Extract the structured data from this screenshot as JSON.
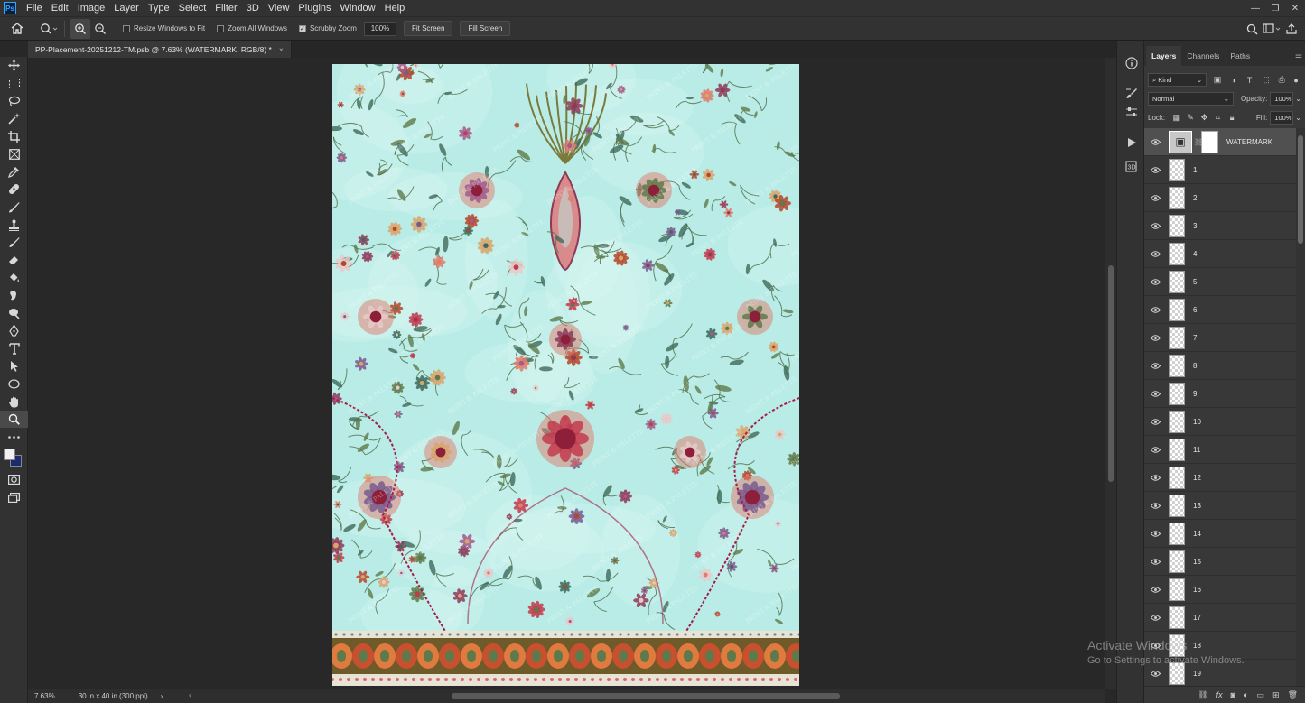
{
  "app": {
    "menu": [
      "File",
      "Edit",
      "Image",
      "Layer",
      "Type",
      "Select",
      "Filter",
      "3D",
      "View",
      "Plugins",
      "Window",
      "Help"
    ],
    "logo": "Ps"
  },
  "options": {
    "resize_windows": "Resize Windows to Fit",
    "zoom_all_windows": "Zoom All Windows",
    "scrubby_zoom": "Scrubby Zoom",
    "zoom_value": "100%",
    "fit_screen": "Fit Screen",
    "fill_screen": "Fill Screen"
  },
  "document": {
    "tab_title": "PP-Placement-20251212-TM.psb @ 7.63% (WATERMARK, RGB/8) *",
    "close": "×"
  },
  "status": {
    "zoom": "7.63%",
    "doc_info": "30 in x 40 in (300 ppi)",
    "arrow": "›"
  },
  "panel": {
    "tabs": [
      "Layers",
      "Channels",
      "Paths"
    ],
    "kind": "Kind",
    "blend_mode": "Normal",
    "opacity_label": "Opacity:",
    "opacity_value": "100%",
    "lock_label": "Lock:",
    "fill_label": "Fill:",
    "fill_value": "100%"
  },
  "layers": [
    {
      "name": "WATERMARK",
      "selected": true
    },
    {
      "name": "1"
    },
    {
      "name": "2"
    },
    {
      "name": "3"
    },
    {
      "name": "4"
    },
    {
      "name": "5"
    },
    {
      "name": "6"
    },
    {
      "name": "7"
    },
    {
      "name": "8"
    },
    {
      "name": "9"
    },
    {
      "name": "10"
    },
    {
      "name": "11"
    },
    {
      "name": "12"
    },
    {
      "name": "13"
    },
    {
      "name": "14"
    },
    {
      "name": "15"
    },
    {
      "name": "16"
    },
    {
      "name": "17"
    },
    {
      "name": "18"
    },
    {
      "name": "19"
    }
  ],
  "os_watermark": {
    "line1": "Activate Windows",
    "line2": "Go to Settings to activate Windows."
  },
  "colors": {
    "foreground": "#f1f0f4",
    "background": "#1c2b6e",
    "canvas_mint": "#b9ece6",
    "border_floral": "#b5452c"
  },
  "artwork_text": "PRINT & PALETTE"
}
